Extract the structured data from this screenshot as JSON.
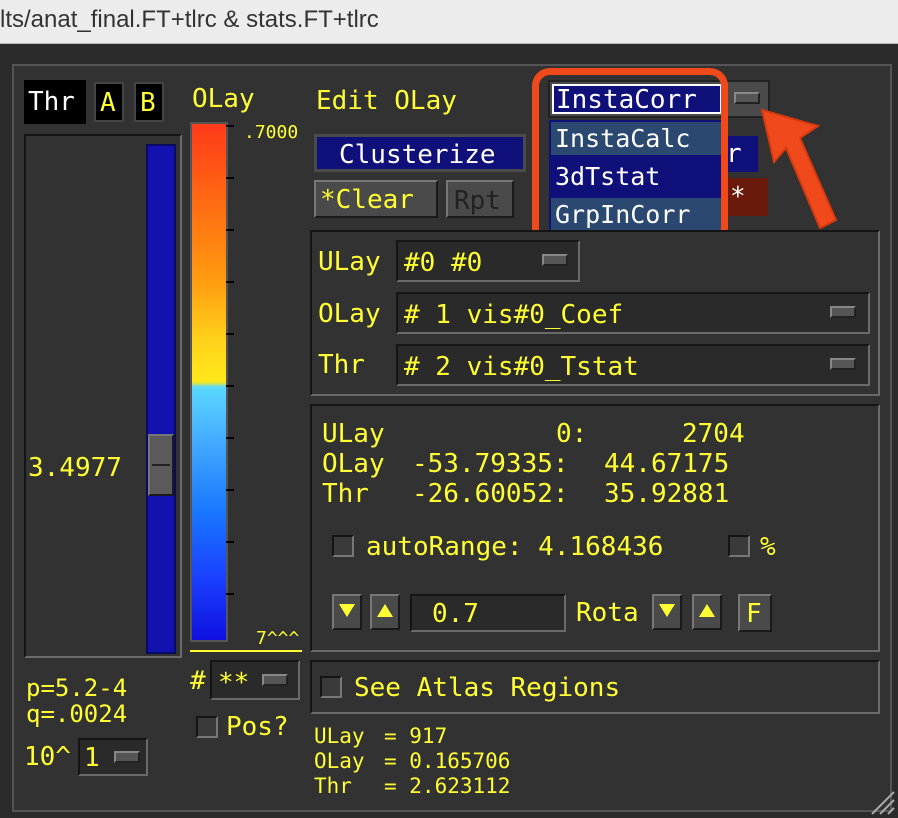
{
  "window": {
    "title": "lts/anat_final.FT+tlrc & stats.FT+tlrc"
  },
  "thr_panel": {
    "thr_label": "Thr",
    "a_label": "A",
    "b_label": "B",
    "value": "3.4977",
    "p_value": "p=5.2-4",
    "q_value": "q=.0024",
    "exp_label": "10^",
    "exp_value": "1"
  },
  "colorbar": {
    "title": "OLay",
    "top_label": ".7000",
    "bottom_label": "7^^^",
    "num_label": "#",
    "pane_value": "**",
    "pos_label": "Pos?"
  },
  "edit": {
    "label": "Edit OLay"
  },
  "mode_menu": {
    "selected": "InstaCorr",
    "options": [
      "InstaCalc",
      "3dTstat",
      "GrpInCorr"
    ]
  },
  "buttons": {
    "clusterize": "Clusterize",
    "clear": "*Clear",
    "rpt": "Rpt",
    "hidden_r": "r",
    "hidden_star": "*"
  },
  "datasets": [
    {
      "label": "ULay",
      "value": "#0 #0"
    },
    {
      "label": "OLay",
      "value": "# 1 vis#0_Coef"
    },
    {
      "label": "Thr",
      "value": "# 2 vis#0_Tstat"
    }
  ],
  "ranges": [
    {
      "label": "ULay",
      "min": "0:",
      "max": "2704"
    },
    {
      "label": "OLay",
      "min": "-53.79335:",
      "max": "44.67175"
    },
    {
      "label": "Thr",
      "min": "-26.60052:",
      "max": "35.92881"
    }
  ],
  "autorange": {
    "label": "autoRange: 4.168436",
    "percent": "%"
  },
  "scale": {
    "value": "0.7",
    "rota_label": "Rota",
    "f_label": "F"
  },
  "atlas": {
    "label": "See Atlas Regions"
  },
  "values": [
    {
      "label": "ULay",
      "text": "= 917"
    },
    {
      "label": "OLay",
      "text": "= 0.165706"
    },
    {
      "label": "Thr",
      "text": "= 2.623112"
    }
  ],
  "colors": {
    "annotation": "#f04a1c",
    "text": "#ffff33",
    "accent_blue": "#10107a",
    "menu_item": "#2a4870"
  }
}
